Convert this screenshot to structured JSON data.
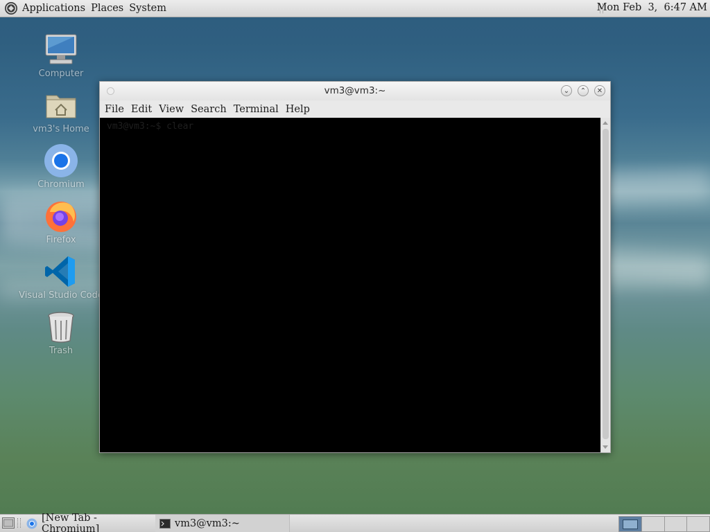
{
  "top_panel": {
    "menus": [
      "Applications",
      "Places",
      "System"
    ],
    "clock": "Mon Feb  3,  6:47 AM",
    "logo_icon": "distro-logo-icon"
  },
  "desktop": {
    "icons": [
      {
        "label": "Computer",
        "icon": "computer-icon"
      },
      {
        "label": "vm3's Home",
        "icon": "home-folder-icon"
      },
      {
        "label": "Chromium",
        "icon": "chromium-icon"
      },
      {
        "label": "Firefox",
        "icon": "firefox-icon"
      },
      {
        "label": "Visual Studio Code",
        "icon": "vscode-icon"
      },
      {
        "label": "Trash",
        "icon": "trash-icon"
      }
    ]
  },
  "terminal": {
    "title": "vm3@vm3:~",
    "menu": [
      "File",
      "Edit",
      "View",
      "Search",
      "Terminal",
      "Help"
    ],
    "prompt": "vm3@vm3:~$ clear",
    "background": "#000000"
  },
  "taskbar": {
    "tasks": [
      {
        "label": "[New Tab - Chromium]",
        "icon": "chromium-icon"
      },
      {
        "label": "vm3@vm3:~",
        "icon": "terminal-icon"
      }
    ],
    "workspaces": 4,
    "active_workspace": 1
  },
  "colors": {
    "panel_bg": "#dcdcdc",
    "workspace_active": "#5e7ea0"
  }
}
